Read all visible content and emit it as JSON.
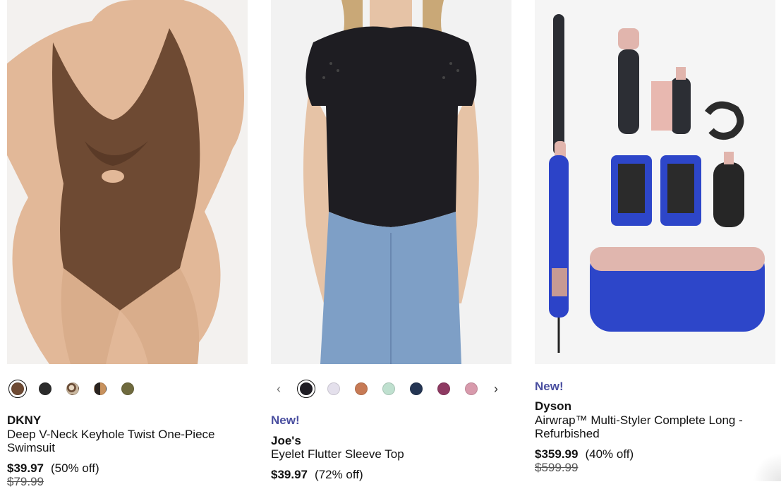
{
  "products": [
    {
      "brand": "DKNY",
      "badge": "",
      "title": "Deep V-Neck Keyhole Twist One-Piece Swimsuit",
      "sale_price": "$39.97",
      "discount": "(50% off)",
      "original_price": "$79.99",
      "image_icon": "swimsuit-image",
      "swatches": [
        "#6e4a33",
        "#2b2b2b",
        "#b49e86",
        "#3a2c22",
        "#6f6a3e"
      ],
      "selected_swatch": 0
    },
    {
      "brand": "Joe's",
      "badge": "New!",
      "title": "Eyelet Flutter Sleeve Top",
      "sale_price": "$39.97",
      "discount": "(72% off)",
      "original_price": "",
      "image_icon": "black-top-image",
      "swatches": [
        "#1f1d24",
        "#e4e0ec",
        "#c77a55",
        "#bfe0cf",
        "#243553",
        "#8e3a62",
        "#d89aac"
      ],
      "selected_swatch": 0
    },
    {
      "brand": "Dyson",
      "badge": "New!",
      "title": "Airwrap™ Multi-Styler Complete Long - Refurbished",
      "sale_price": "$359.99",
      "discount": "(40% off)",
      "original_price": "$599.99",
      "image_icon": "hair-styler-set-image",
      "swatches": [],
      "selected_swatch": null
    }
  ],
  "colors": {
    "new_badge": "#4a4fa0",
    "text": "#121212"
  },
  "icons": {
    "prev": "chevron-left-icon",
    "next": "chevron-right-icon"
  }
}
